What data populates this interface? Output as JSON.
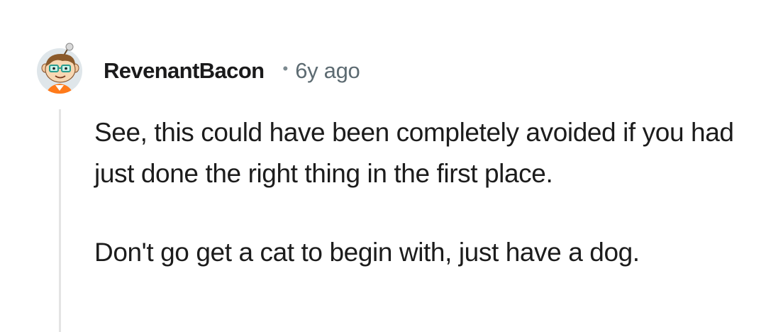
{
  "comment": {
    "author": "RevenantBacon",
    "separator": "•",
    "age": "6y ago",
    "avatar_icon": "snoo-avatar-icon",
    "paragraphs": [
      "See, this could have been completely avoided if you had just done the right thing in the first place.",
      "Don't go get a cat to begin with, just have a dog."
    ]
  },
  "colors": {
    "background": "#ffffff",
    "username": "#1a1a1b",
    "meta": "#5d6b72",
    "body_text": "#1c1c1c",
    "thread_line": "#e4e4e4",
    "avatar_bg": "#dfe6ea",
    "avatar_shirt": "#ff7a1a"
  }
}
